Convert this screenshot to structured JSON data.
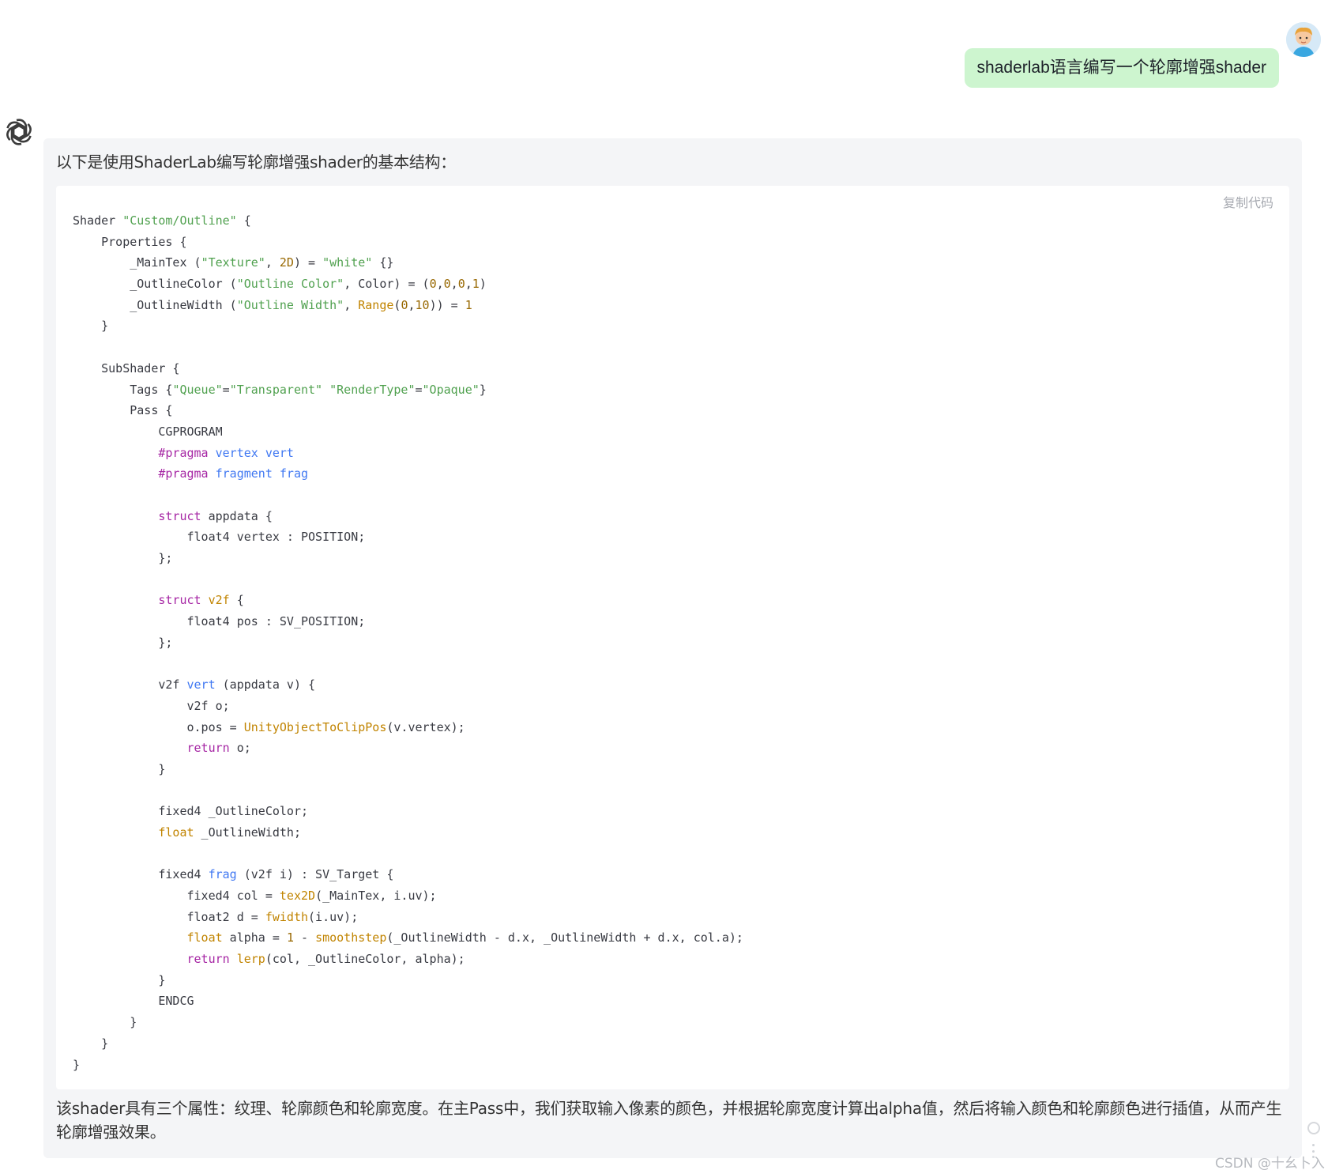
{
  "user_message": {
    "text": "shaderlab语言编写一个轮廓增强shader"
  },
  "icons": {
    "user_avatar": "user-avatar-icon",
    "bot_avatar": "openai-logo-icon",
    "more": "more-dots-icon"
  },
  "answer": {
    "intro": "以下是使用ShaderLab编写轮廓增强shader的基本结构：",
    "copy_label": "复制代码",
    "code_lines": [
      [
        [
          "t",
          "Shader "
        ],
        [
          "s",
          "\"Custom/Outline\""
        ],
        [
          "t",
          " {"
        ]
      ],
      [
        [
          "t",
          "    Properties {"
        ]
      ],
      [
        [
          "t",
          "        _MainTex ("
        ],
        [
          "s",
          "\"Texture\""
        ],
        [
          "t",
          ", "
        ],
        [
          "n",
          "2D"
        ],
        [
          "t",
          ") = "
        ],
        [
          "s",
          "\"white\""
        ],
        [
          "t",
          " {}"
        ]
      ],
      [
        [
          "t",
          "        _OutlineColor ("
        ],
        [
          "s",
          "\"Outline Color\""
        ],
        [
          "t",
          ", Color) = ("
        ],
        [
          "n",
          "0"
        ],
        [
          "t",
          ","
        ],
        [
          "n",
          "0"
        ],
        [
          "t",
          ","
        ],
        [
          "n",
          "0"
        ],
        [
          "t",
          ","
        ],
        [
          "n",
          "1"
        ],
        [
          "t",
          ")"
        ]
      ],
      [
        [
          "t",
          "        _OutlineWidth ("
        ],
        [
          "s",
          "\"Outline Width\""
        ],
        [
          "t",
          ", "
        ],
        [
          "b",
          "Range"
        ],
        [
          "t",
          "("
        ],
        [
          "n",
          "0"
        ],
        [
          "t",
          ","
        ],
        [
          "n",
          "10"
        ],
        [
          "t",
          ")) = "
        ],
        [
          "n",
          "1"
        ]
      ],
      [
        [
          "t",
          "    }"
        ]
      ],
      [
        [
          "t",
          ""
        ]
      ],
      [
        [
          "t",
          "    SubShader {"
        ]
      ],
      [
        [
          "t",
          "        Tags {"
        ],
        [
          "s",
          "\"Queue\""
        ],
        [
          "t",
          "="
        ],
        [
          "s",
          "\"Transparent\""
        ],
        [
          "t",
          " "
        ],
        [
          "s",
          "\"RenderType\""
        ],
        [
          "t",
          "="
        ],
        [
          "s",
          "\"Opaque\""
        ],
        [
          "t",
          "}"
        ]
      ],
      [
        [
          "t",
          "        Pass {"
        ]
      ],
      [
        [
          "t",
          "            CGPROGRAM"
        ]
      ],
      [
        [
          "t",
          "            "
        ],
        [
          "k",
          "#pragma"
        ],
        [
          "t",
          " "
        ],
        [
          "f",
          "vertex vert"
        ]
      ],
      [
        [
          "t",
          "            "
        ],
        [
          "k",
          "#pragma"
        ],
        [
          "t",
          " "
        ],
        [
          "f",
          "fragment frag"
        ]
      ],
      [
        [
          "t",
          ""
        ]
      ],
      [
        [
          "t",
          "            "
        ],
        [
          "k",
          "struct"
        ],
        [
          "t",
          " appdata {"
        ]
      ],
      [
        [
          "t",
          "                float4 vertex : POSITION;"
        ]
      ],
      [
        [
          "t",
          "            };"
        ]
      ],
      [
        [
          "t",
          ""
        ]
      ],
      [
        [
          "t",
          "            "
        ],
        [
          "k",
          "struct"
        ],
        [
          "t",
          " "
        ],
        [
          "b",
          "v2f"
        ],
        [
          "t",
          " {"
        ]
      ],
      [
        [
          "t",
          "                float4 pos : SV_POSITION;"
        ]
      ],
      [
        [
          "t",
          "            };"
        ]
      ],
      [
        [
          "t",
          ""
        ]
      ],
      [
        [
          "t",
          "            v2f "
        ],
        [
          "f",
          "vert"
        ],
        [
          "t",
          " (appdata v) {"
        ]
      ],
      [
        [
          "t",
          "                v2f o;"
        ]
      ],
      [
        [
          "t",
          "                o.pos = "
        ],
        [
          "b",
          "UnityObjectToClipPos"
        ],
        [
          "t",
          "(v.vertex);"
        ]
      ],
      [
        [
          "t",
          "                "
        ],
        [
          "k",
          "return"
        ],
        [
          "t",
          " o;"
        ]
      ],
      [
        [
          "t",
          "            }"
        ]
      ],
      [
        [
          "t",
          ""
        ]
      ],
      [
        [
          "t",
          "            fixed4 _OutlineColor;"
        ]
      ],
      [
        [
          "t",
          "            "
        ],
        [
          "b",
          "float"
        ],
        [
          "t",
          " _OutlineWidth;"
        ]
      ],
      [
        [
          "t",
          ""
        ]
      ],
      [
        [
          "t",
          "            fixed4 "
        ],
        [
          "f",
          "frag"
        ],
        [
          "t",
          " (v2f i) : SV_Target {"
        ]
      ],
      [
        [
          "t",
          "                fixed4 col = "
        ],
        [
          "b",
          "tex2D"
        ],
        [
          "t",
          "(_MainTex, i.uv);"
        ]
      ],
      [
        [
          "t",
          "                float2 d = "
        ],
        [
          "b",
          "fwidth"
        ],
        [
          "t",
          "(i.uv);"
        ]
      ],
      [
        [
          "t",
          "                "
        ],
        [
          "b",
          "float"
        ],
        [
          "t",
          " alpha = "
        ],
        [
          "n",
          "1"
        ],
        [
          "t",
          " - "
        ],
        [
          "b",
          "smoothstep"
        ],
        [
          "t",
          "(_OutlineWidth - d.x, _OutlineWidth + d.x, col.a);"
        ]
      ],
      [
        [
          "t",
          "                "
        ],
        [
          "k",
          "return"
        ],
        [
          "t",
          " "
        ],
        [
          "b",
          "lerp"
        ],
        [
          "t",
          "(col, _OutlineColor, alpha);"
        ]
      ],
      [
        [
          "t",
          "            }"
        ]
      ],
      [
        [
          "t",
          "            ENDCG"
        ]
      ],
      [
        [
          "t",
          "        }"
        ]
      ],
      [
        [
          "t",
          "    }"
        ]
      ],
      [
        [
          "t",
          "}"
        ]
      ]
    ],
    "summary": "该shader具有三个属性：纹理、轮廓颜色和轮廓宽度。在主Pass中，我们获取输入像素的颜色，并根据轮廓宽度计算出alpha值，然后将输入颜色和轮廓颜色进行插值，从而产生轮廓增强效果。"
  },
  "watermark": "CSDN @十幺卜入",
  "colors": {
    "user_bubble_bg": "#cdf5cf",
    "card_bg": "#f4f5f7",
    "code_string": "#50a14f",
    "code_number": "#986801",
    "code_keyword": "#a626a4",
    "code_function": "#4078f2",
    "code_builtin": "#c18401"
  }
}
